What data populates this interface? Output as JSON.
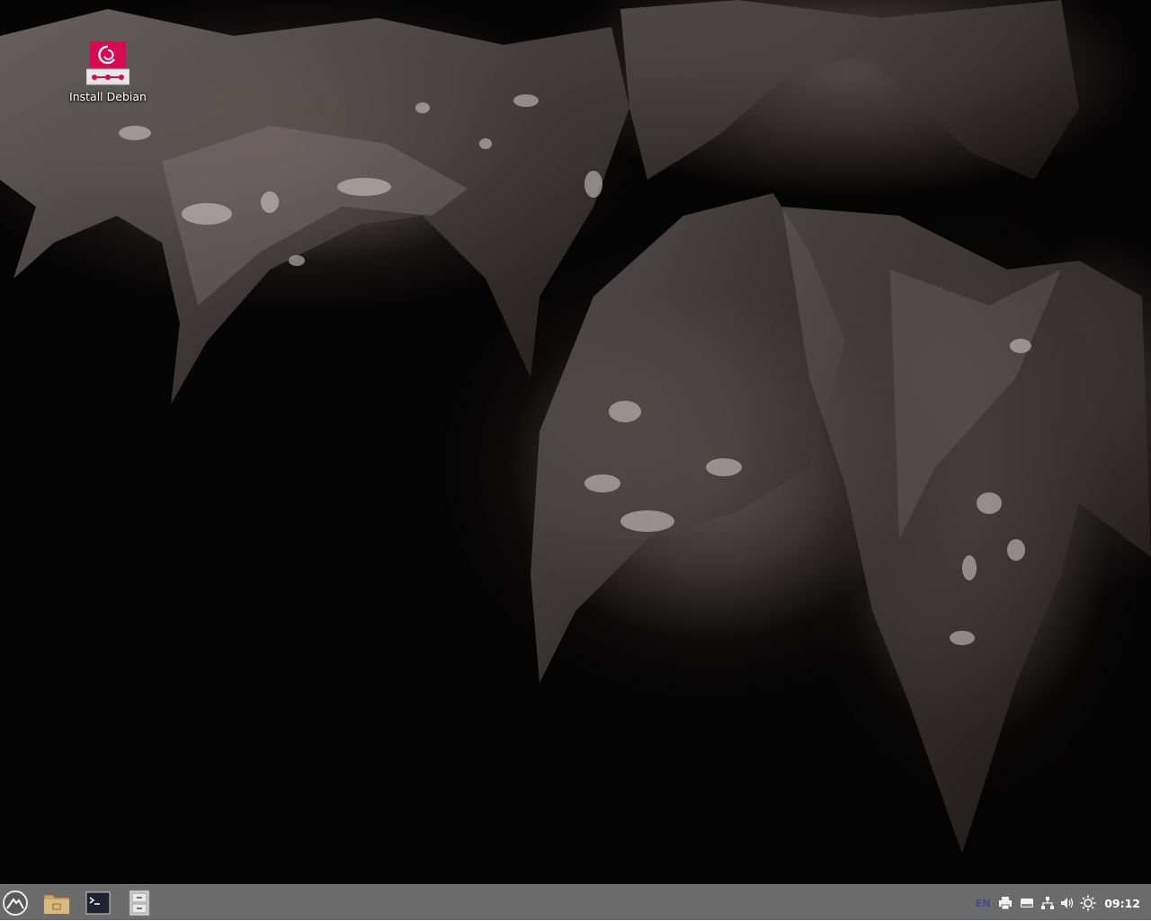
{
  "desktop": {
    "icons": [
      {
        "label": "Install Debian",
        "icon": "debian-installer-icon"
      }
    ]
  },
  "taskbar": {
    "launchers": [
      {
        "icon": "app-menu-icon"
      },
      {
        "icon": "file-manager-icon"
      },
      {
        "icon": "terminal-icon"
      },
      {
        "icon": "file-cabinet-icon"
      }
    ],
    "tray": {
      "keyboard_layout": "EN",
      "icons": [
        "printer-icon",
        "drive-icon",
        "network-icon",
        "volume-icon",
        "brightness-icon"
      ],
      "clock": "09:12"
    }
  },
  "colors": {
    "taskbar_bg": "#6b6b6b",
    "debian_red": "#d70a53",
    "desktop_bg": "#050404"
  }
}
